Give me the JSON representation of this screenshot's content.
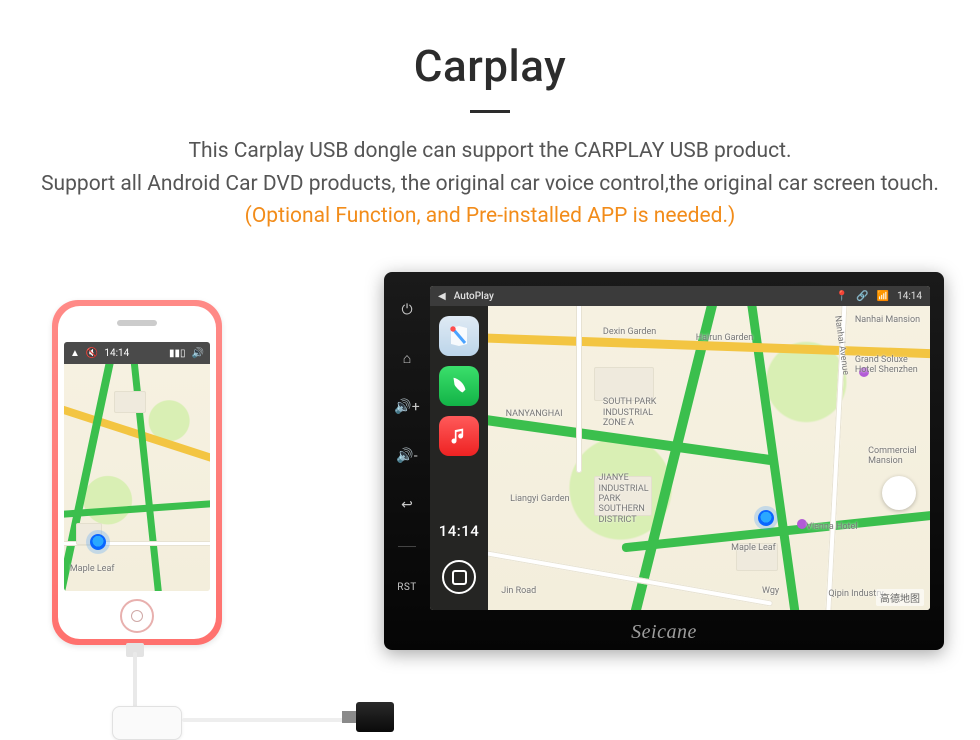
{
  "hero": {
    "title": "Carplay",
    "body": "This Carplay USB dongle can support the CARPLAY USB product.\nSupport all Android Car DVD products, the original car voice control,the original car screen touch.",
    "note": "(Optional Function, and Pre-installed APP is needed.)"
  },
  "phone": {
    "status": {
      "nav_icon": "▲",
      "mute_icon": "🔇",
      "time": "14:14",
      "signal_icon": "▮▮▯",
      "vol_icon": "🔊"
    },
    "map": {
      "location_pin": "Maple Leaf"
    }
  },
  "head_unit": {
    "brand": "Seicane",
    "side_buttons": {
      "power": "⏻",
      "home": "⌂",
      "vol_up": "🔊+",
      "vol_down": "🔊-",
      "back": "↩",
      "reset": "RST"
    },
    "status": {
      "back_icon": "◀",
      "title": "AutoPlay",
      "gps_icon": "📍",
      "link_icon": "🔗",
      "signal_icon": "📶",
      "time": "14:14"
    },
    "dock": {
      "apps": [
        {
          "name": "maps",
          "icon": "maps"
        },
        {
          "name": "phone",
          "icon": "phone"
        },
        {
          "name": "music",
          "icon": "music"
        }
      ],
      "time": "14:14"
    },
    "map": {
      "labels": {
        "dexin": "Dexin Garden",
        "hairun": "Hairun Garden",
        "nanyanghai": "NANYANGHAI",
        "southpark": "SOUTH PARK\nINDUSTRIAL\nZONE A",
        "jianye": "JIANYE\nINDUSTRIAL\nPARK\nSOUTHERN\nDISTRICT",
        "liangyi": "Liangyi Garden",
        "nanhai_ave": "Nanhai Avenue",
        "nanhai_mansion": "Nanhai Mansion",
        "grand_soluxe": "Grand Soluxe\nHotel Shenzhen",
        "vienna": "Vienna Hotel",
        "qipin": "Qipin Industry",
        "jin_rd": "Jin Road",
        "wgy": "Wgy",
        "commercial": "Commercial\nMansion",
        "maple": "Maple Leaf"
      },
      "credit": "高德地图"
    }
  }
}
